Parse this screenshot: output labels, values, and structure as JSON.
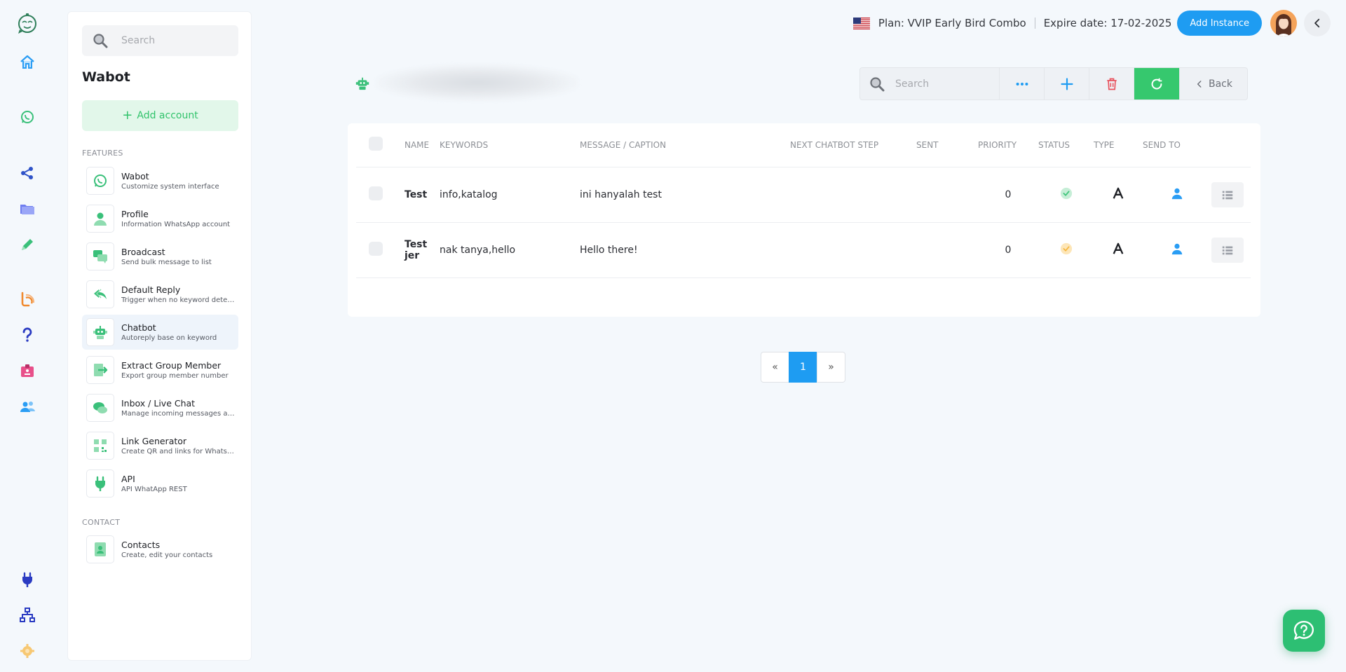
{
  "sidebar": {
    "search_placeholder": "Search",
    "title": "Wabot",
    "add_account_label": "Add account",
    "features_label": "FEATURES",
    "contact_label": "CONTACT",
    "items": [
      {
        "title": "Wabot",
        "subtitle": "Customize system interface",
        "icon": "whatsapp-icon"
      },
      {
        "title": "Profile",
        "subtitle": "Information WhatsApp account",
        "icon": "user-icon"
      },
      {
        "title": "Broadcast",
        "subtitle": "Send bulk message to list",
        "icon": "broadcast-icon"
      },
      {
        "title": "Default Reply",
        "subtitle": "Trigger when no keyword detected",
        "icon": "reply-icon"
      },
      {
        "title": "Chatbot",
        "subtitle": "Autoreply base on keyword",
        "icon": "robot-icon"
      },
      {
        "title": "Extract Group Member",
        "subtitle": "Export group member number",
        "icon": "export-icon"
      },
      {
        "title": "Inbox / Live Chat",
        "subtitle": "Manage incoming messages and live chat",
        "icon": "chat-icon"
      },
      {
        "title": "Link Generator",
        "subtitle": "Create QR and links for WhatsApp",
        "icon": "qr-icon"
      },
      {
        "title": "API",
        "subtitle": "API WhatApp REST",
        "icon": "plug-icon"
      }
    ],
    "contact_items": [
      {
        "title": "Contacts",
        "subtitle": "Create, edit your contacts",
        "icon": "contact-book-icon"
      }
    ]
  },
  "topbar": {
    "plan": "Plan: VVIP Early Bird Combo",
    "expire": "Expire date: 17-02-2025",
    "add_instance_label": "Add Instance"
  },
  "toolbar": {
    "search_placeholder": "Search",
    "back_label": "Back"
  },
  "table": {
    "headers": [
      "NAME",
      "KEYWORDS",
      "MESSAGE / CAPTION",
      "NEXT CHATBOT STEP",
      "SENT",
      "PRIORITY",
      "STATUS",
      "TYPE",
      "SEND TO"
    ],
    "rows": [
      {
        "name": "Test",
        "keywords": "info,katalog",
        "message": "ini hanyalah test",
        "next_step": "",
        "sent": "",
        "priority": "0",
        "status": "active",
        "status_color": "#3ec57a",
        "type": "A"
      },
      {
        "name": "Test jer",
        "keywords": "nak tanya,hello",
        "message": "Hello there!",
        "next_step": "",
        "sent": "",
        "priority": "0",
        "status": "pending",
        "status_color": "#f5b741",
        "type": "A"
      }
    ]
  },
  "pagination": {
    "prev": "«",
    "current": "1",
    "next": "»"
  },
  "colors": {
    "accent_blue": "#1e9cf2",
    "accent_green": "#36c86e",
    "delete_red": "#e8505b"
  }
}
